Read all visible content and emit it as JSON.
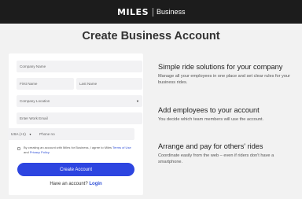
{
  "header": {
    "logo": "MILES",
    "product": "Business"
  },
  "page": {
    "title": "Create Business Account"
  },
  "form": {
    "company_name_placeholder": "Company Name",
    "first_name_placeholder": "First Name",
    "last_name_placeholder": "Last Name",
    "company_location_placeholder": "Company Location",
    "work_email_placeholder": "Enter Work Email",
    "country_code": "USA (+1)",
    "phone_placeholder": "Phone no",
    "terms_prefix": "By creating an account with Miles for Business, I agree to Miles",
    "terms_link": "Terms of Use",
    "terms_and": "and",
    "privacy_link": "Privacy Policy",
    "terms_suffix": ".",
    "submit_label": "Create Account",
    "login_prompt": "Have an account?",
    "login_link": "Login"
  },
  "features": [
    {
      "title": "Simple ride solutions for your company",
      "description": "Manage all your employees in one place and set clear rules for your business rides."
    },
    {
      "title": "Add employees to your account",
      "description": "You decide which team members will use the account."
    },
    {
      "title": "Arrange and pay for others' rides",
      "description": "Coordinate easily from the web – even if riders don't have a smartphone."
    }
  ],
  "colors": {
    "primary": "#2d45e0",
    "header_bg": "#1c1c1c",
    "page_bg": "#f2f2f2"
  },
  "icons": {
    "select_chevron": "chevron-down-icon"
  }
}
